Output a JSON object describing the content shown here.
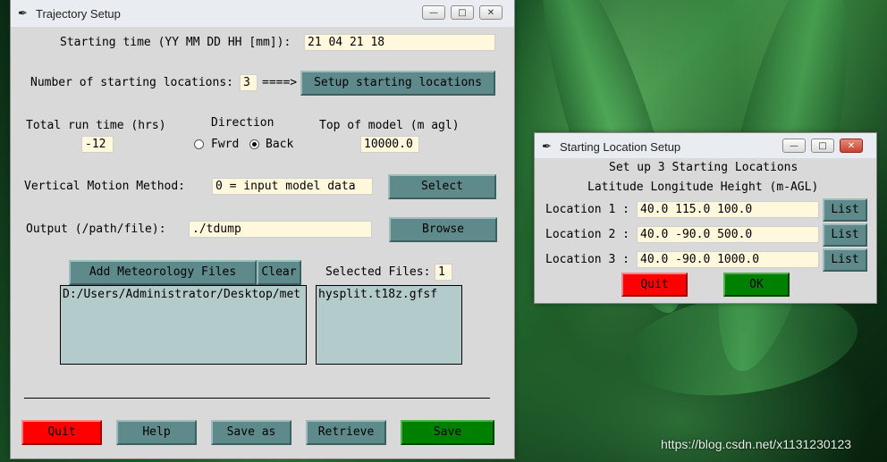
{
  "desktop": {
    "watermark": "https://blog.csdn.net/x1131230123"
  },
  "main_window": {
    "title": "Trajectory Setup",
    "title_icon": "feather-icon",
    "start_time_label": "Starting time (YY MM DD HH [mm]):",
    "start_time_value": "21 04 21 18",
    "num_locations_label": "Number of starting locations:",
    "num_locations_value": "3",
    "arrow": "====>",
    "setup_locations_button": "Setup starting locations",
    "run_time_label": "Total run time (hrs)",
    "run_time_value": "-12",
    "direction_label": "Direction",
    "direction_forward": "Fwrd",
    "direction_back": "Back",
    "direction_selected": "Back",
    "top_model_label": "Top of model (m agl)",
    "top_model_value": "10000.0",
    "vertical_label": "Vertical Motion Method:",
    "vertical_value": "0 = input model data",
    "select_button": "Select",
    "output_label": "Output (/path/file):",
    "output_value": "./tdump",
    "browse_button": "Browse",
    "add_met_button": "Add Meteorology Files",
    "clear_button": "Clear",
    "selected_files_label": "Selected Files:",
    "selected_files_count": "1",
    "met_dir_items": [
      "D:/Users/Administrator/Desktop/met"
    ],
    "met_file_items": [
      "hysplit.t18z.gfsf"
    ],
    "buttons": {
      "quit": "Quit",
      "help": "Help",
      "save_as": "Save as",
      "retrieve": "Retrieve",
      "save": "Save"
    }
  },
  "location_window": {
    "title": "Starting Location Setup",
    "header1": "Set up 3 Starting Locations",
    "header2": "Latitude Longitude Height (m-AGL)",
    "locations": [
      {
        "label": "Location 1 :",
        "value": "40.0 115.0   100.0",
        "button": "List"
      },
      {
        "label": "Location 2 :",
        "value": "40.0 -90.0  500.0",
        "button": "List"
      },
      {
        "label": "Location 3 :",
        "value": "40.0 -90.0 1000.0",
        "button": "List"
      }
    ],
    "quit_button": "Quit",
    "ok_button": "OK"
  },
  "colors": {
    "tk_button": "#5f8a8b",
    "entry_bg": "#fff8dc",
    "listbox_bg": "#b3cbcb",
    "quit": "#ff0000",
    "ok": "#008000"
  }
}
